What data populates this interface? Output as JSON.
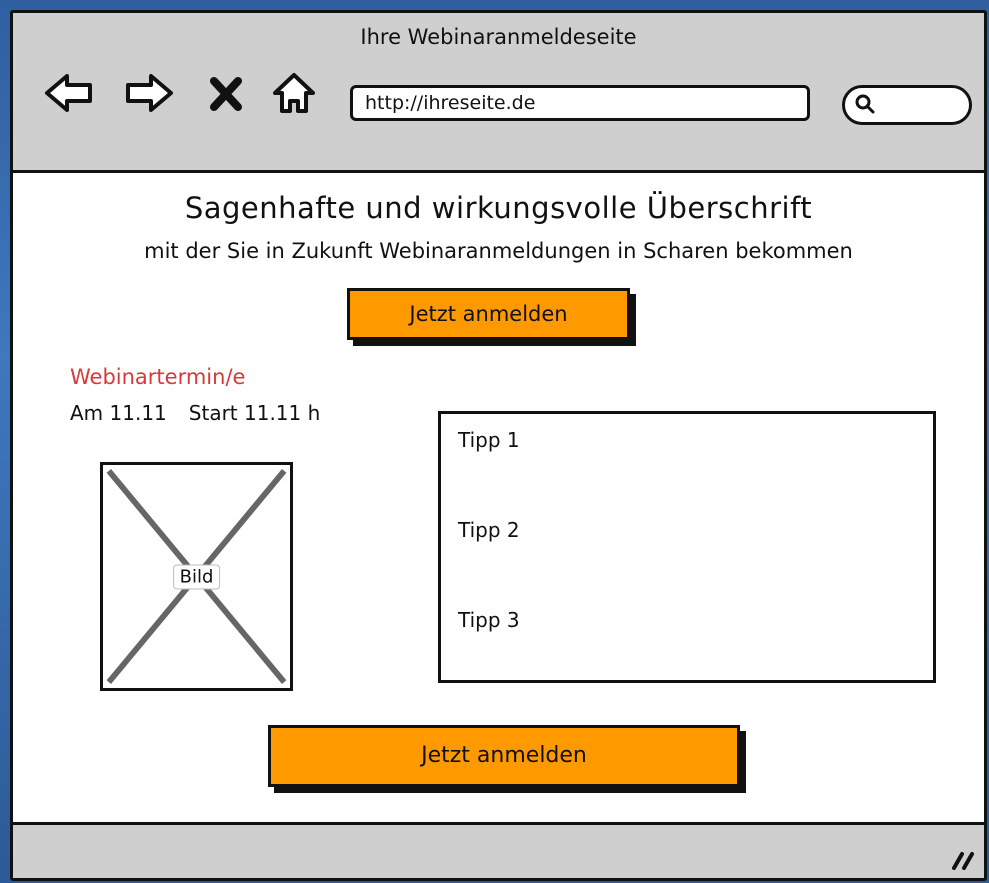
{
  "window": {
    "title": "Ihre Webinaranmeldeseite"
  },
  "browser": {
    "back_icon": "back-arrow-icon",
    "forward_icon": "forward-arrow-icon",
    "stop_icon": "close-icon",
    "home_icon": "home-icon",
    "url": "http://ihreseite.de",
    "search_icon": "search-icon"
  },
  "page": {
    "headline": "Sagenhafte und wirkungsvolle Überschrift",
    "subheadline": "mit der Sie in Zukunft Webinaranmeldungen in Scharen bekommen",
    "cta_top_label": "Jetzt anmelden",
    "webinar_label": "Webinartermin/e",
    "webinar_date": "Am 11.11",
    "webinar_start": "Start 11.11 h",
    "image_label": "Bild",
    "tips": [
      "Tipp 1",
      "Tipp 2",
      "Tipp 3"
    ],
    "cta_bottom_label": "Jetzt anmelden"
  },
  "colors": {
    "background": "#3a6fb0",
    "chrome": "#cfcfcf",
    "cta": "#ff9900",
    "accent_text": "#d63a3a"
  }
}
